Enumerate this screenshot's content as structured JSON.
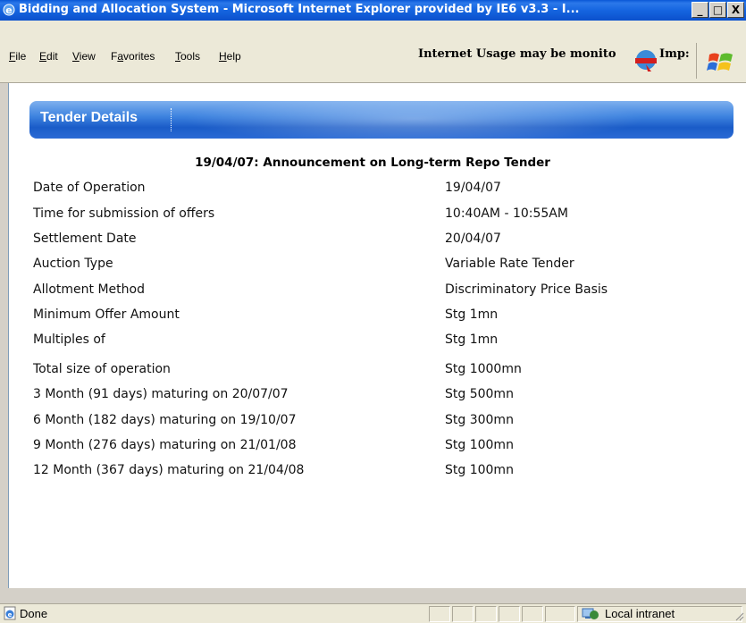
{
  "window": {
    "title": "Bidding and Allocation System - Microsoft Internet Explorer provided by IE6 v3.3 - I...",
    "minimize_label": "_",
    "maximize_label": "□",
    "close_label": "X"
  },
  "menubar": {
    "items": [
      {
        "label": "File",
        "accel": "F"
      },
      {
        "label": "Edit",
        "accel": "E"
      },
      {
        "label": "View",
        "accel": "V"
      },
      {
        "label": "Favorites",
        "accel": "a"
      },
      {
        "label": "Tools",
        "accel": "T"
      },
      {
        "label": "Help",
        "accel": "H"
      }
    ],
    "notice_text": "Internet Usage may be monitored. Imp",
    "notice_visible": "Internet Usage may be monito",
    "notice_tail": "Imp:"
  },
  "page": {
    "banner_title": "Tender Details",
    "heading": "19/04/07: Announcement on Long-term Repo Tender",
    "rows": [
      {
        "label": "Date of Operation",
        "value": "19/04/07"
      },
      {
        "label": "Time for submission of offers",
        "value": "10:40AM - 10:55AM"
      },
      {
        "label": "Settlement Date",
        "value": "20/04/07"
      },
      {
        "label": "Auction Type",
        "value": "Variable Rate Tender"
      },
      {
        "label": "Allotment Method",
        "value": "Discriminatory Price Basis"
      },
      {
        "label": "Minimum Offer Amount",
        "value": "Stg 1mn"
      },
      {
        "label": "Multiples of",
        "value": "Stg 1mn"
      },
      {
        "label": "Total size of operation",
        "value": "Stg 1000mn"
      },
      {
        "label": "3 Month (91 days) maturing on 20/07/07",
        "value": "Stg 500mn"
      },
      {
        "label": "6 Month (182 days) maturing on 19/10/07",
        "value": "Stg 300mn"
      },
      {
        "label": "9 Month (276 days) maturing on 21/01/08",
        "value": "Stg 100mn"
      },
      {
        "label": "12 Month (367 days) maturing on 21/04/08",
        "value": "Stg 100mn"
      }
    ]
  },
  "statusbar": {
    "status": "Done",
    "zone": "Local intranet"
  },
  "colors": {
    "titlebar": "#0b50cc",
    "banner": "#2a6ad4",
    "chrome": "#ece9d8"
  }
}
